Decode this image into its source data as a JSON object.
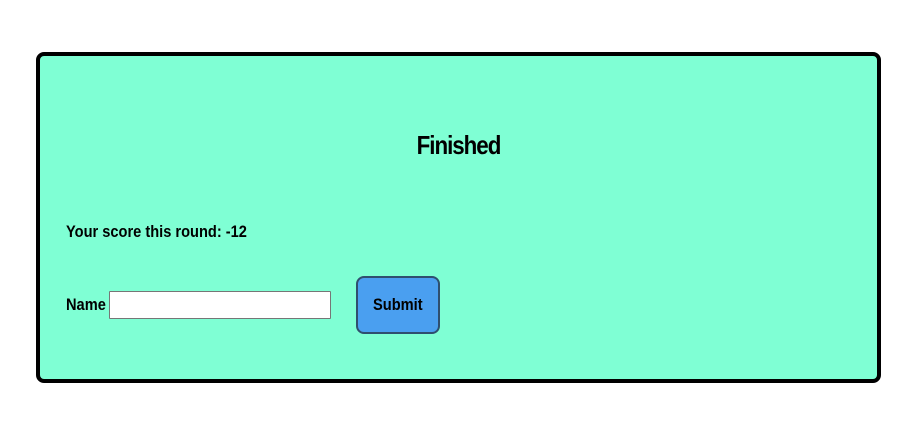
{
  "panel": {
    "title": "Finished",
    "score_label": "Your score this round:",
    "score_value": "-12",
    "name_label": "Name",
    "name_value": "",
    "name_placeholder": "",
    "submit_label": "Submit"
  },
  "colors": {
    "panel_background": "#7fffd4",
    "panel_border": "#000000",
    "button_background": "#4a9ff0"
  }
}
